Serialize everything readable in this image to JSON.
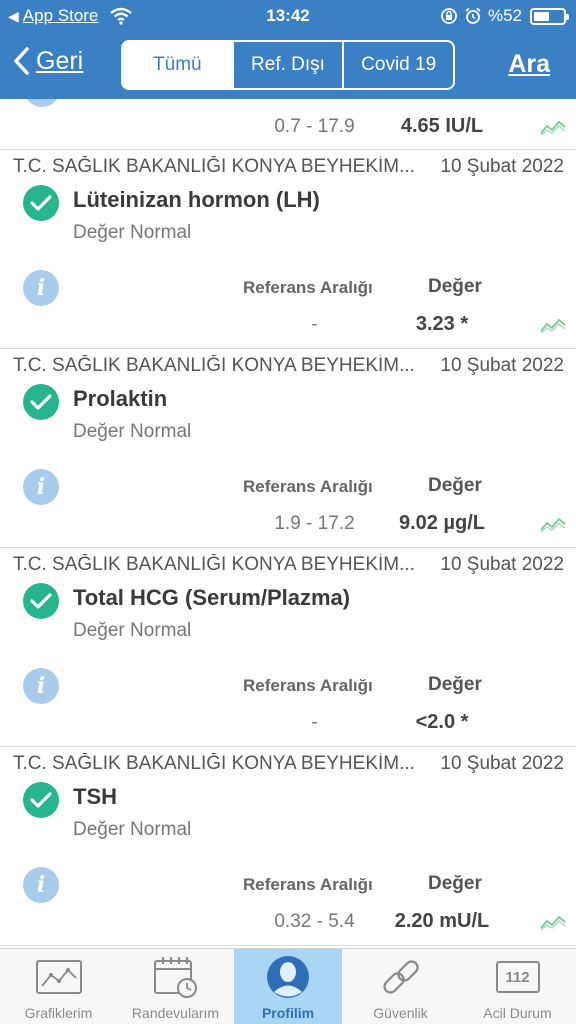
{
  "status_bar": {
    "back_app": "App Store",
    "time": "13:42",
    "battery": "%52",
    "battery_level": 0.52
  },
  "nav": {
    "back_label": "Geri",
    "segments": [
      "Tümü",
      "Ref. Dışı",
      "Covid 19"
    ],
    "active_segment": 0,
    "search_label": "Ara"
  },
  "partial_result": {
    "reference": "0.7 - 17.9",
    "value": "4.65 IU/L"
  },
  "labels": {
    "reference_header": "Referans Aralığı",
    "value_header": "Değer"
  },
  "results": [
    {
      "institution": "T.C. SAĞLIK BAKANLIĞI KONYA BEYHEKİM...",
      "date": "10 Şubat 2022",
      "name": "Lüteinizan hormon (LH)",
      "status": "Değer Normal",
      "reference": "-",
      "value": "3.23 *",
      "has_chart": true
    },
    {
      "institution": "T.C. SAĞLIK BAKANLIĞI KONYA BEYHEKİM...",
      "date": "10 Şubat 2022",
      "name": "Prolaktin",
      "status": "Değer Normal",
      "reference": "1.9 - 17.2",
      "value": "9.02 µg/L",
      "has_chart": true
    },
    {
      "institution": "T.C. SAĞLIK BAKANLIĞI KONYA BEYHEKİM...",
      "date": "10 Şubat 2022",
      "name": "Total HCG (Serum/Plazma)",
      "status": "Değer Normal",
      "reference": "-",
      "value": "<2.0 *",
      "has_chart": false
    },
    {
      "institution": "T.C. SAĞLIK BAKANLIĞI KONYA BEYHEKİM...",
      "date": "10 Şubat 2022",
      "name": "TSH",
      "status": "Değer Normal",
      "reference": "0.32 - 5.4",
      "value": "2.20 mU/L",
      "has_chart": true
    }
  ],
  "tabs": [
    {
      "label": "Grafiklerim",
      "icon": "chart-icon"
    },
    {
      "label": "Randevularım",
      "icon": "calendar-icon"
    },
    {
      "label": "Profilim",
      "icon": "profile-icon"
    },
    {
      "label": "Güvenlik",
      "icon": "link-icon"
    },
    {
      "label": "Acil Durum",
      "icon": "emergency-112-icon",
      "icon_text": "112"
    }
  ],
  "active_tab": 2,
  "colors": {
    "header": "#3b7fc4",
    "check": "#26b58f",
    "info": "#a9cbec",
    "active_tab": "#a9d6f5"
  }
}
